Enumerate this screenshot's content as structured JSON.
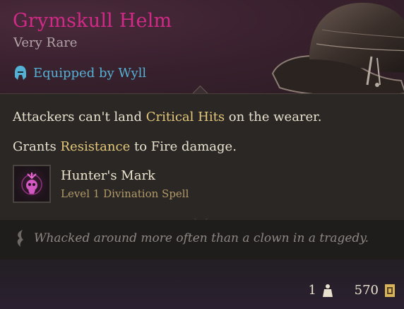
{
  "item": {
    "name": "Grymskull Helm",
    "rarity": "Very Rare",
    "equipped_by": "Equipped by Wyll",
    "icon": "helmet-icon"
  },
  "effects": {
    "line1_pre": "Attackers can't land ",
    "line1_kw": "Critical Hits",
    "line1_post": " on the wearer.",
    "line2_pre": "Grants ",
    "line2_kw": "Resistance",
    "line2_post": " to Fire damage."
  },
  "spell": {
    "name": "Hunter's Mark",
    "subtitle": "Level 1 Divination Spell",
    "icon": "hunters-mark-icon"
  },
  "flavor": {
    "text": "Whacked around more often than a clown in a tragedy.",
    "icon": "quill-icon"
  },
  "footer": {
    "weight": "1",
    "price": "570"
  },
  "colors": {
    "title": "#d12a86",
    "equipped": "#54b1d6",
    "keyword": "#e5c97a"
  }
}
